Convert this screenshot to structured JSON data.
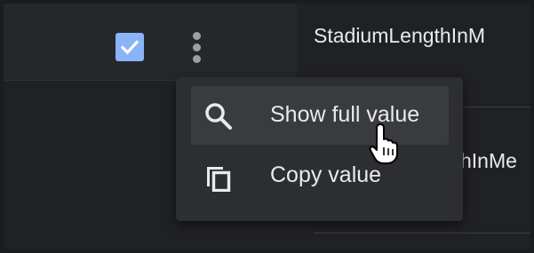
{
  "table": {
    "header_cell": "StadiumLengthInM",
    "row_cell": "hInMe"
  },
  "row_controls": {
    "checkbox_checked": true,
    "more_options_icon": "more-vert-icon"
  },
  "context_menu": {
    "items": [
      {
        "label": "Show full value",
        "icon": "search-icon"
      },
      {
        "label": "Copy value",
        "icon": "copy-icon"
      }
    ]
  },
  "colors": {
    "background": "#202124",
    "menu_background": "#2d2e31",
    "menu_hover": "#3a3b3f",
    "checkbox_accent": "#8ab4f8",
    "text": "#e8eaed"
  }
}
